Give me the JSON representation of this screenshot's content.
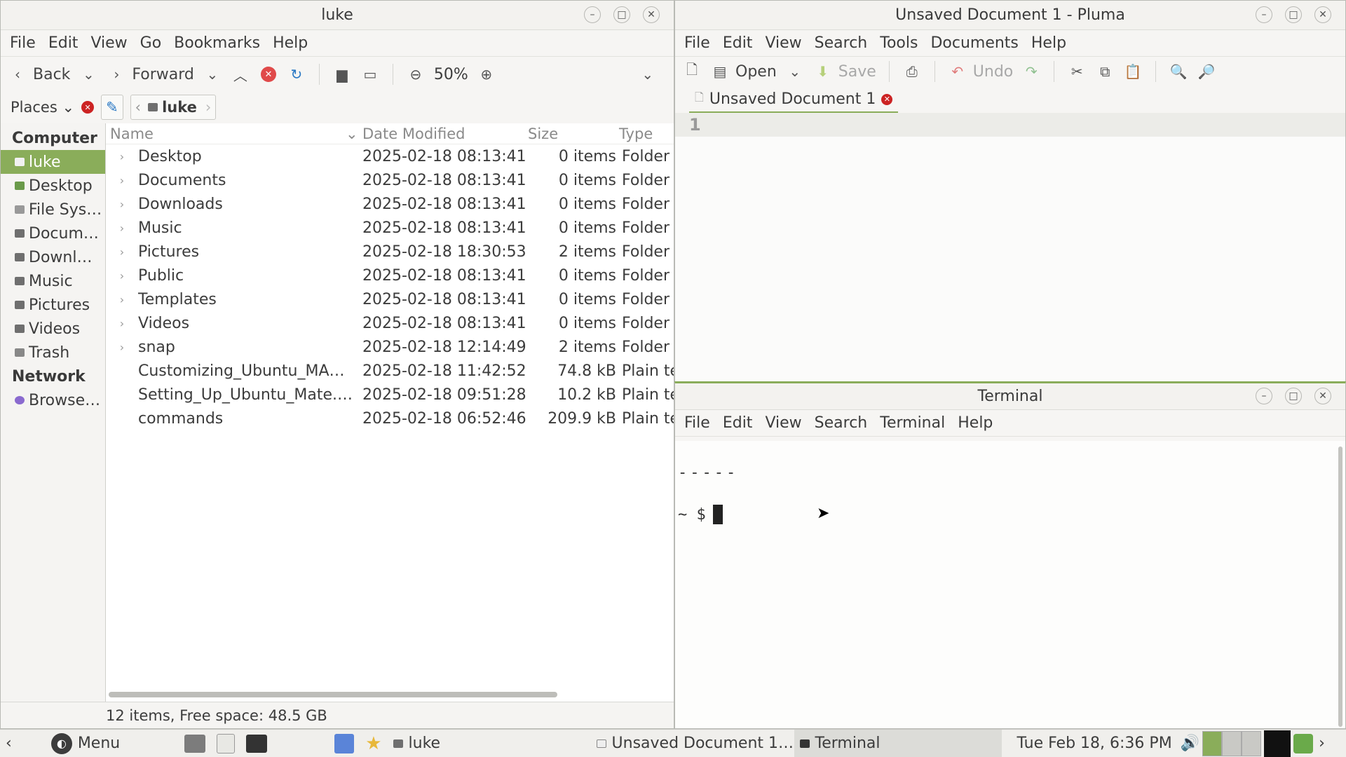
{
  "file_manager": {
    "title": "luke",
    "menu": [
      "File",
      "Edit",
      "View",
      "Go",
      "Bookmarks",
      "Help"
    ],
    "toolbar": {
      "back": "Back",
      "forward": "Forward",
      "zoom": "50%"
    },
    "places_label": "Places",
    "path_current": "luke",
    "sidebar": {
      "computer_header": "Computer",
      "computer_items": [
        "luke",
        "Desktop",
        "File Sys…",
        "Docum…",
        "Downl…",
        "Music",
        "Pictures",
        "Videos",
        "Trash"
      ],
      "network_header": "Network",
      "network_items": [
        "Browse…"
      ]
    },
    "columns": {
      "name": "Name",
      "date": "Date Modified",
      "size": "Size",
      "type": "Type"
    },
    "rows": [
      {
        "name": "Desktop",
        "date": "2025-02-18 08:13:41",
        "size": "0 items",
        "type": "Folder"
      },
      {
        "name": "Documents",
        "date": "2025-02-18 08:13:41",
        "size": "0 items",
        "type": "Folder"
      },
      {
        "name": "Downloads",
        "date": "2025-02-18 08:13:41",
        "size": "0 items",
        "type": "Folder"
      },
      {
        "name": "Music",
        "date": "2025-02-18 08:13:41",
        "size": "0 items",
        "type": "Folder"
      },
      {
        "name": "Pictures",
        "date": "2025-02-18 18:30:53",
        "size": "2 items",
        "type": "Folder"
      },
      {
        "name": "Public",
        "date": "2025-02-18 08:13:41",
        "size": "0 items",
        "type": "Folder"
      },
      {
        "name": "Templates",
        "date": "2025-02-18 08:13:41",
        "size": "0 items",
        "type": "Folder"
      },
      {
        "name": "Videos",
        "date": "2025-02-18 08:13:41",
        "size": "0 items",
        "type": "Folder"
      },
      {
        "name": "snap",
        "date": "2025-02-18 12:14:49",
        "size": "2 items",
        "type": "Folder"
      },
      {
        "name": "Customizing_Ubuntu_MA…",
        "date": "2025-02-18 11:42:52",
        "size": "74.8 kB",
        "type": "Plain te"
      },
      {
        "name": "Setting_Up_Ubuntu_Mate.…",
        "date": "2025-02-18 09:51:28",
        "size": "10.2 kB",
        "type": "Plain te"
      },
      {
        "name": "commands",
        "date": "2025-02-18 06:52:46",
        "size": "209.9 kB",
        "type": "Plain te"
      }
    ],
    "status": "12 items, Free space: 48.5 GB"
  },
  "pluma": {
    "title": "Unsaved Document 1 - Pluma",
    "menu": [
      "File",
      "Edit",
      "View",
      "Search",
      "Tools",
      "Documents",
      "Help"
    ],
    "toolbar": {
      "open": "Open",
      "save": "Save",
      "undo": "Undo"
    },
    "tab_label": "Unsaved Document 1",
    "line_number": "1"
  },
  "terminal": {
    "title": "Terminal",
    "menu": [
      "File",
      "Edit",
      "View",
      "Search",
      "Terminal",
      "Help"
    ],
    "line1": "-----",
    "prompt": "~ $"
  },
  "taskbar": {
    "menu_label": "Menu",
    "tasks": [
      "luke",
      "Unsaved Document 1…",
      "Terminal"
    ],
    "clock": "Tue Feb 18,  6:36 PM"
  },
  "colors": {
    "accent": "#8aad5a",
    "close_red": "#cc2323"
  }
}
